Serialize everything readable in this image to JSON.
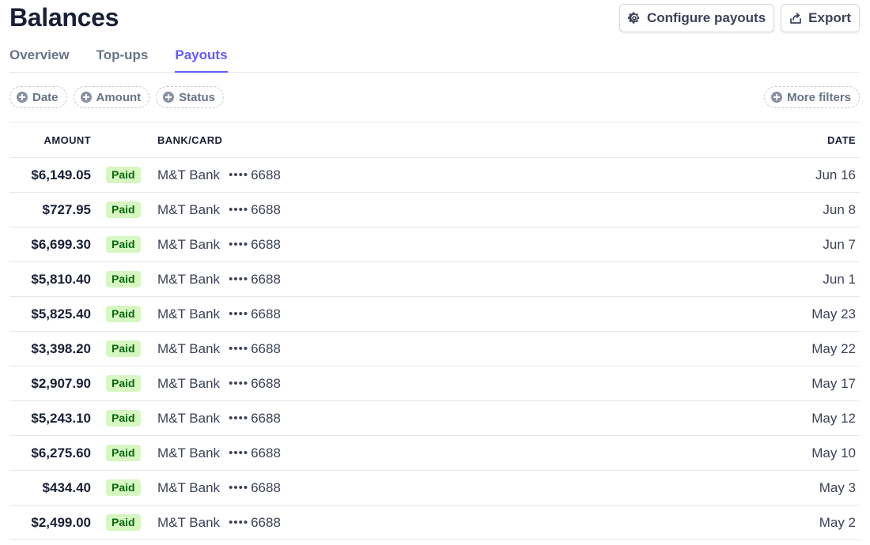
{
  "header": {
    "title": "Balances",
    "configure_label": "Configure payouts",
    "export_label": "Export"
  },
  "tabs": [
    {
      "label": "Overview",
      "active": false
    },
    {
      "label": "Top-ups",
      "active": false
    },
    {
      "label": "Payouts",
      "active": true
    }
  ],
  "filters": {
    "date": "Date",
    "amount": "Amount",
    "status": "Status",
    "more": "More filters"
  },
  "table": {
    "columns": {
      "amount": "AMOUNT",
      "bank": "BANK/CARD",
      "date": "DATE"
    },
    "rows": [
      {
        "amount": "$6,149.05",
        "status": "Paid",
        "bank": "M&T Bank",
        "dots": "••••",
        "last4": "6688",
        "date": "Jun 16"
      },
      {
        "amount": "$727.95",
        "status": "Paid",
        "bank": "M&T Bank",
        "dots": "••••",
        "last4": "6688",
        "date": "Jun 8"
      },
      {
        "amount": "$6,699.30",
        "status": "Paid",
        "bank": "M&T Bank",
        "dots": "••••",
        "last4": "6688",
        "date": "Jun 7"
      },
      {
        "amount": "$5,810.40",
        "status": "Paid",
        "bank": "M&T Bank",
        "dots": "••••",
        "last4": "6688",
        "date": "Jun 1"
      },
      {
        "amount": "$5,825.40",
        "status": "Paid",
        "bank": "M&T Bank",
        "dots": "••••",
        "last4": "6688",
        "date": "May 23"
      },
      {
        "amount": "$3,398.20",
        "status": "Paid",
        "bank": "M&T Bank",
        "dots": "••••",
        "last4": "6688",
        "date": "May 22"
      },
      {
        "amount": "$2,907.90",
        "status": "Paid",
        "bank": "M&T Bank",
        "dots": "••••",
        "last4": "6688",
        "date": "May 17"
      },
      {
        "amount": "$5,243.10",
        "status": "Paid",
        "bank": "M&T Bank",
        "dots": "••••",
        "last4": "6688",
        "date": "May 12"
      },
      {
        "amount": "$6,275.60",
        "status": "Paid",
        "bank": "M&T Bank",
        "dots": "••••",
        "last4": "6688",
        "date": "May 10"
      },
      {
        "amount": "$434.40",
        "status": "Paid",
        "bank": "M&T Bank",
        "dots": "••••",
        "last4": "6688",
        "date": "May 3"
      },
      {
        "amount": "$2,499.00",
        "status": "Paid",
        "bank": "M&T Bank",
        "dots": "••••",
        "last4": "6688",
        "date": "May 2"
      }
    ]
  },
  "colors": {
    "accent": "#635bff",
    "paid_bg": "#d7f7c2",
    "paid_text": "#05690d",
    "icons": [
      "gear-icon",
      "export-icon",
      "plus-circle-icon"
    ]
  }
}
